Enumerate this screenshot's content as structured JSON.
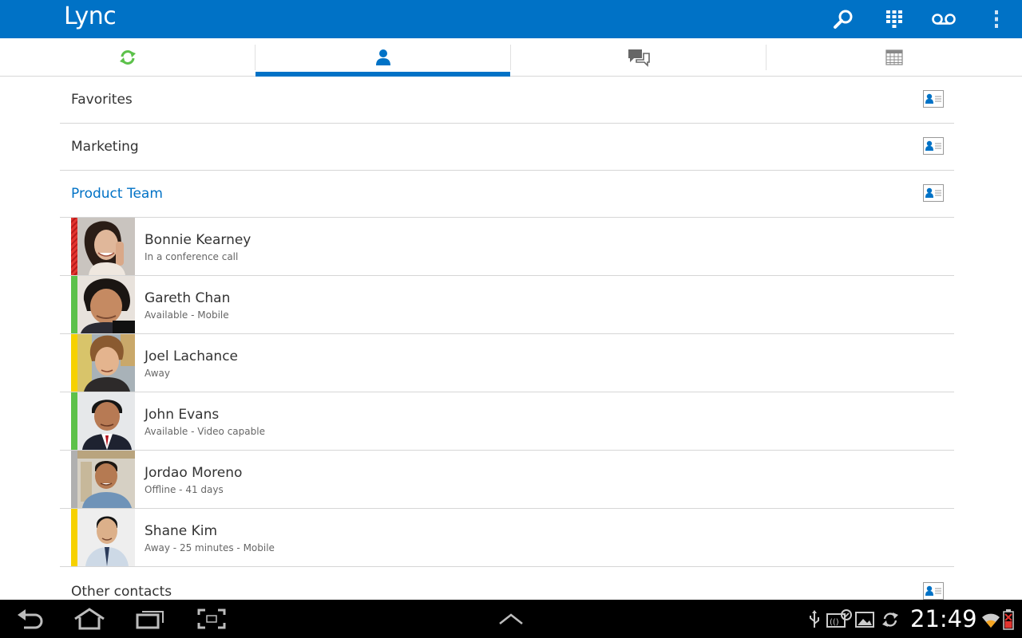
{
  "app": {
    "title": "Lync"
  },
  "colors": {
    "accent": "#0072c6",
    "available": "#5cc14a",
    "away": "#f6d100",
    "busy": "#e3342f",
    "offline": "#b0b0b0"
  },
  "actions": [
    "search-icon",
    "dialpad-icon",
    "voicemail-icon",
    "overflow-menu-icon"
  ],
  "tabs": [
    {
      "icon": "refresh-icon",
      "active": false
    },
    {
      "icon": "contacts-icon",
      "active": true
    },
    {
      "icon": "conversations-icon",
      "active": false
    },
    {
      "icon": "calendar-icon",
      "active": false
    }
  ],
  "groups": {
    "favorites": "Favorites",
    "marketing": "Marketing",
    "product_team": "Product Team",
    "other": "Other contacts"
  },
  "contacts": [
    {
      "name": "Bonnie Kearney",
      "status": "In a conference call",
      "presence": "busy"
    },
    {
      "name": "Gareth Chan",
      "status": "Available - Mobile",
      "presence": "available"
    },
    {
      "name": "Joel Lachance",
      "status": "Away",
      "presence": "away"
    },
    {
      "name": "John Evans",
      "status": "Available - Video capable",
      "presence": "available"
    },
    {
      "name": "Jordao Moreno",
      "status": "Offline - 41 days",
      "presence": "offline"
    },
    {
      "name": "Shane Kim",
      "status": "Away - 25 minutes - Mobile",
      "presence": "away"
    }
  ],
  "system": {
    "clock": "21:49"
  }
}
